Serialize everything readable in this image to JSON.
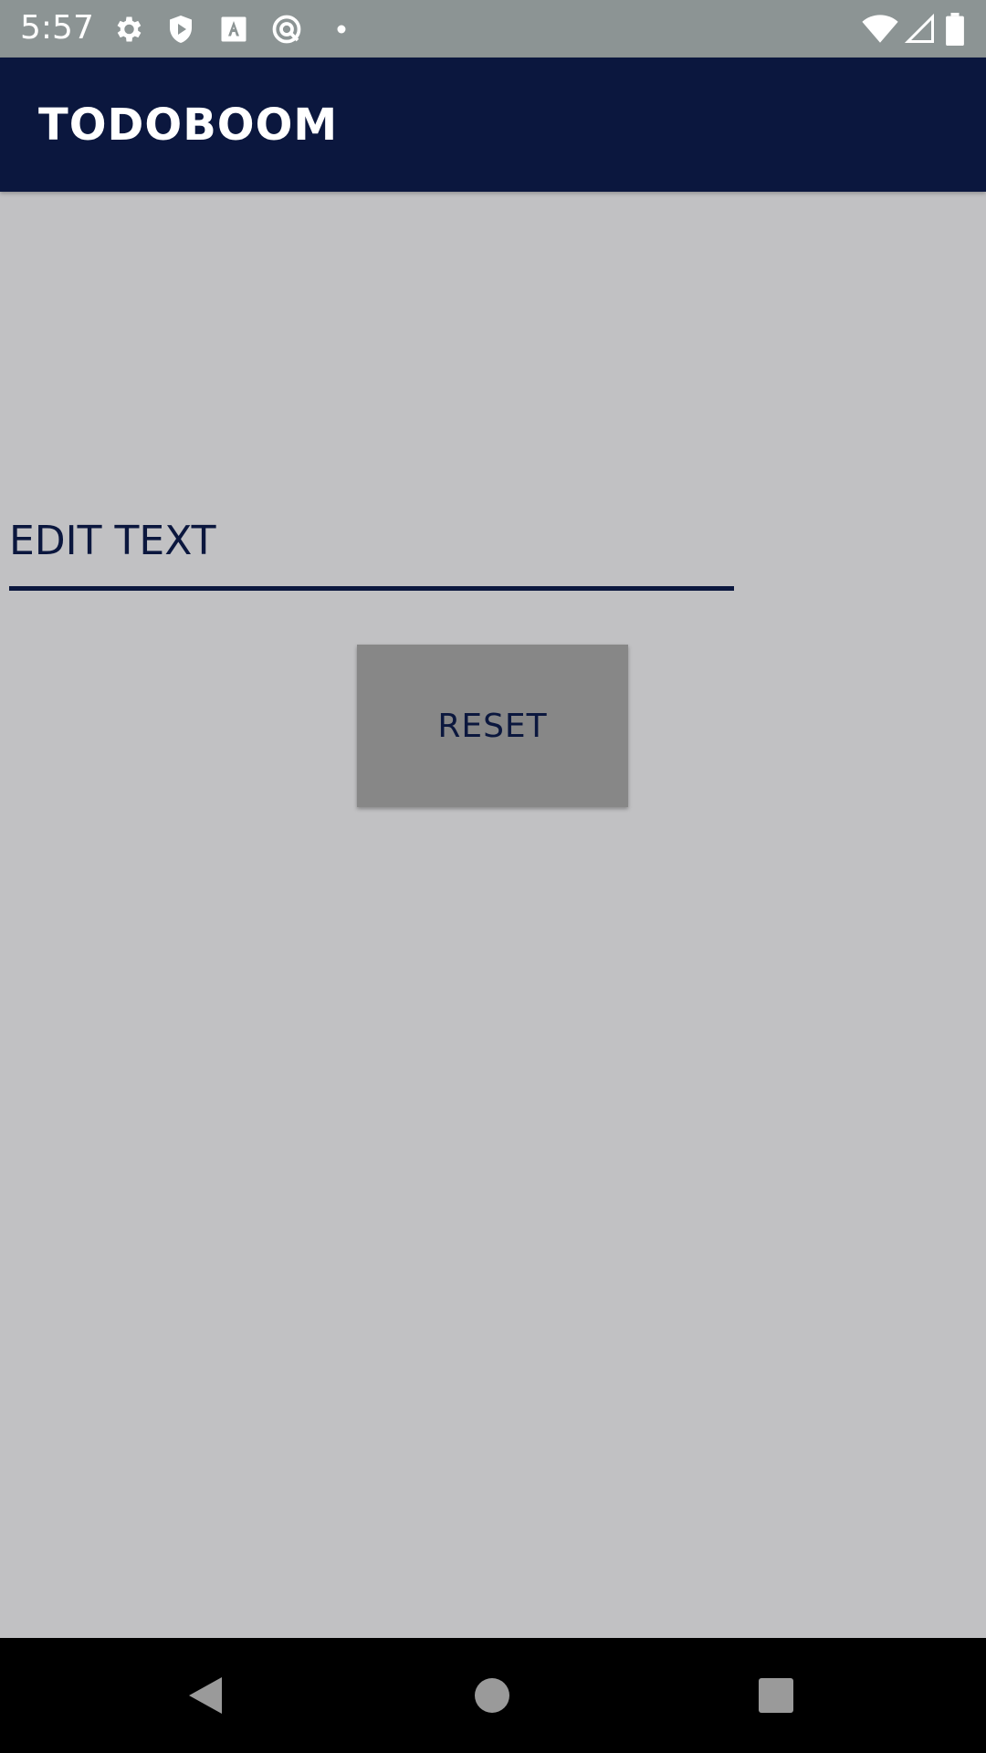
{
  "status_bar": {
    "time": "5:57",
    "icons": [
      "gear-icon",
      "shield-play-icon",
      "a-box-icon",
      "no-circle-icon",
      "dot-icon",
      "wifi-icon",
      "cell-signal-icon",
      "battery-icon"
    ]
  },
  "app_bar": {
    "title": "TODOBOOM",
    "background": "#0b173e"
  },
  "main": {
    "edit_text": {
      "placeholder": "EDIT TEXT",
      "value": ""
    },
    "reset_button": {
      "label": "RESET",
      "background": "#878787"
    },
    "background": "#c1c1c3"
  },
  "nav_bar": {
    "buttons": [
      "back-icon",
      "home-icon",
      "recents-icon"
    ]
  }
}
